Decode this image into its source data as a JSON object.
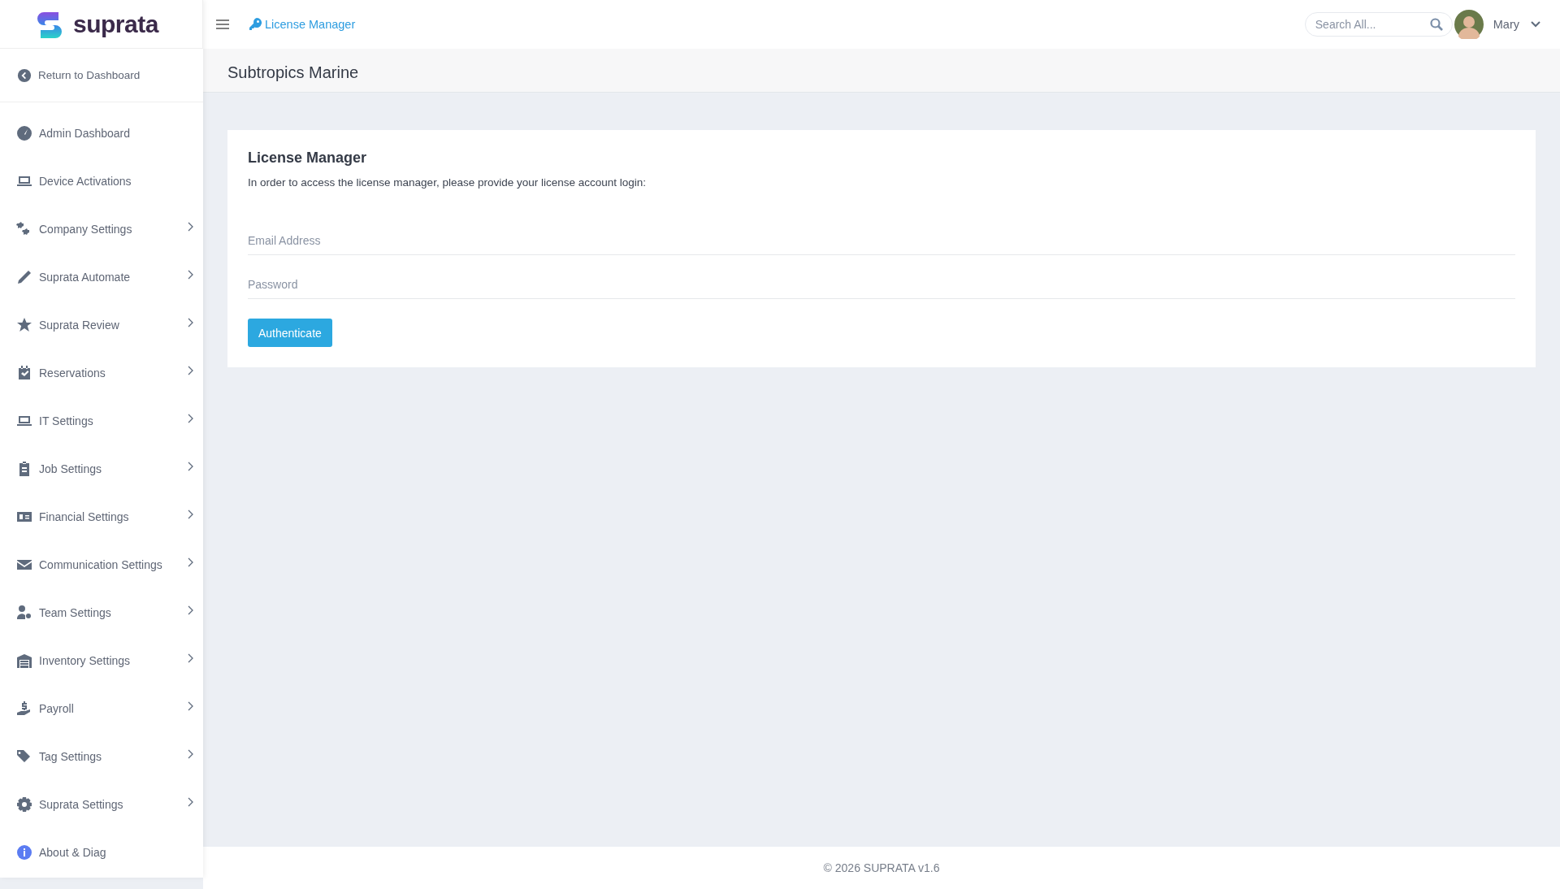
{
  "brand": {
    "name": "suprata"
  },
  "topbar": {
    "breadcrumb": "License Manager",
    "search": {
      "placeholder": "Search All..."
    },
    "user": {
      "name": "Mary"
    }
  },
  "sidebar": {
    "back_link": "Return to Dashboard",
    "items": [
      {
        "label": "Admin Dashboard",
        "has_submenu": false
      },
      {
        "label": "Device Activations",
        "has_submenu": false
      },
      {
        "label": "Company Settings",
        "has_submenu": true
      },
      {
        "label": "Suprata Automate",
        "has_submenu": true
      },
      {
        "label": "Suprata Review",
        "has_submenu": true
      },
      {
        "label": "Reservations",
        "has_submenu": true
      },
      {
        "label": "IT Settings",
        "has_submenu": true
      },
      {
        "label": "Job Settings",
        "has_submenu": true
      },
      {
        "label": "Financial Settings",
        "has_submenu": true
      },
      {
        "label": "Communication Settings",
        "has_submenu": true
      },
      {
        "label": "Team Settings",
        "has_submenu": true
      },
      {
        "label": "Inventory Settings",
        "has_submenu": true
      },
      {
        "label": "Payroll",
        "has_submenu": true
      },
      {
        "label": "Tag Settings",
        "has_submenu": true
      },
      {
        "label": "Suprata Settings",
        "has_submenu": true
      },
      {
        "label": "About & Diag",
        "has_submenu": false
      }
    ]
  },
  "page_title": "Subtropics Marine",
  "card": {
    "title": "License Manager",
    "description": "In order to access the license manager, please provide your license account login:",
    "fields": [
      {
        "placeholder": "Email Address"
      },
      {
        "placeholder": "Password"
      }
    ],
    "button": "Authenticate"
  },
  "footer": "© 2026 SUPRATA v1.6"
}
